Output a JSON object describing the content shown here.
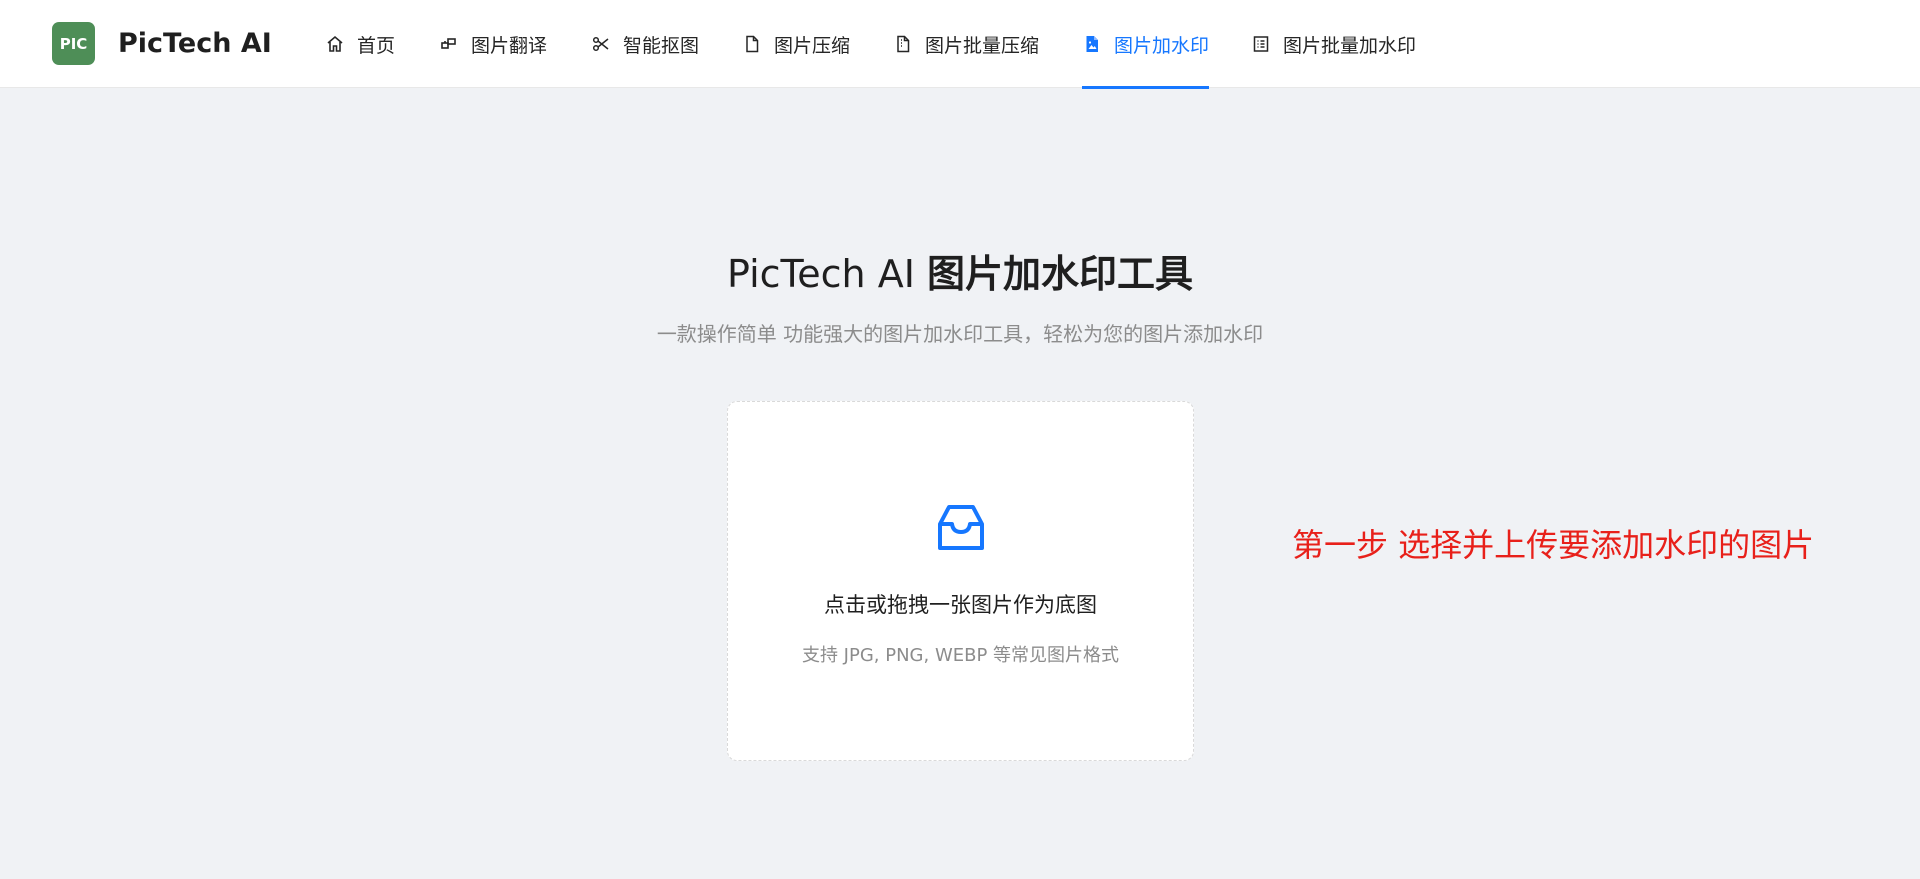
{
  "header": {
    "logo_text": "PIC",
    "brand": "PicTech AI",
    "nav": [
      {
        "label": "首页",
        "icon": "home-icon",
        "active": false
      },
      {
        "label": "图片翻译",
        "icon": "translate-icon",
        "active": false
      },
      {
        "label": "智能抠图",
        "icon": "scissors-icon",
        "active": false
      },
      {
        "label": "图片压缩",
        "icon": "file-icon",
        "active": false
      },
      {
        "label": "图片批量压缩",
        "icon": "files-icon",
        "active": false
      },
      {
        "label": "图片加水印",
        "icon": "file-image-icon",
        "active": true
      },
      {
        "label": "图片批量加水印",
        "icon": "list-icon",
        "active": false
      }
    ]
  },
  "main": {
    "title_prefix": "PicTech AI ",
    "title_main": "图片加水印工具",
    "subtitle": "一款操作简单 功能强大的图片加水印工具，轻松为您的图片添加水印",
    "upload": {
      "icon": "inbox-icon",
      "text": "点击或拖拽一张图片作为底图",
      "hint": "支持 JPG, PNG, WEBP 等常见图片格式"
    },
    "step_note": "第一步 选择并上传要添加水印的图片"
  },
  "colors": {
    "accent": "#1677ff",
    "logo_bg": "#4e8e57",
    "note": "#e8201a",
    "background": "#f0f2f5"
  }
}
